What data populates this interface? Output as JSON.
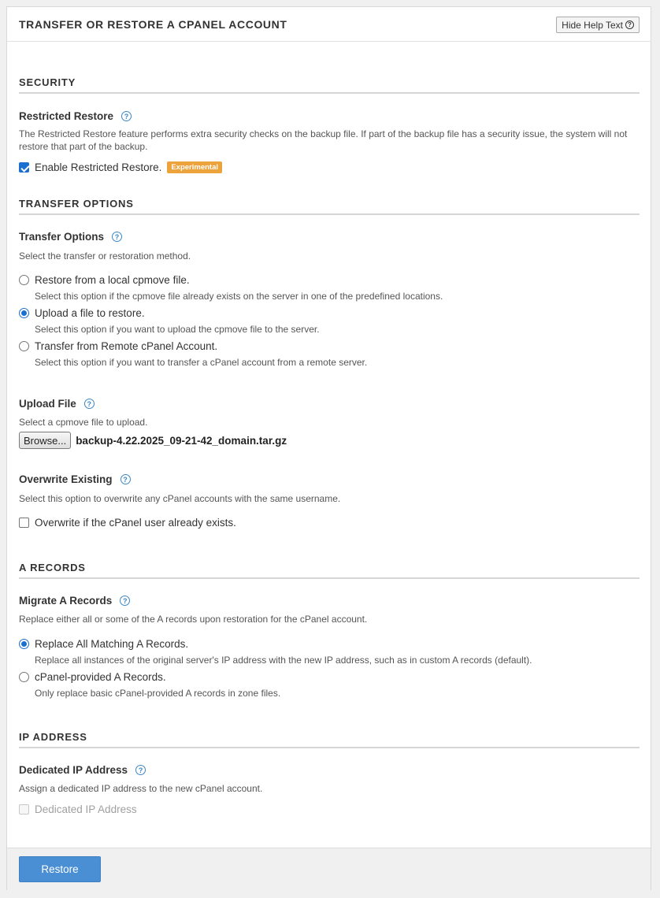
{
  "header": {
    "title": "TRANSFER OR RESTORE A CPANEL ACCOUNT",
    "help_toggle_label": "Hide Help Text"
  },
  "security": {
    "section_title": "SECURITY",
    "restricted_restore": {
      "label": "Restricted Restore",
      "help": "The Restricted Restore feature performs extra security checks on the backup file. If part of the backup file has a security issue, the system will not restore that part of the backup.",
      "checkbox_label": "Enable Restricted Restore.",
      "checked": true,
      "badge": "Experimental",
      "badge_color": "#eda33c"
    }
  },
  "transfer_options": {
    "section_title": "TRANSFER OPTIONS",
    "label": "Transfer Options",
    "help": "Select the transfer or restoration method.",
    "options": [
      {
        "label": "Restore from a local cpmove file.",
        "desc": "Select this option if the cpmove file already exists on the server in one of the predefined locations.",
        "selected": false
      },
      {
        "label": "Upload a file to restore.",
        "desc": "Select this option if you want to upload the cpmove file to the server.",
        "selected": true
      },
      {
        "label": "Transfer from Remote cPanel Account.",
        "desc": "Select this option if you want to transfer a cPanel account from a remote server.",
        "selected": false
      }
    ]
  },
  "upload_file": {
    "label": "Upload File",
    "help": "Select a cpmove file to upload.",
    "browse_label": "Browse...",
    "file_name": "backup-4.22.2025_09-21-42_domain.tar.gz"
  },
  "overwrite": {
    "label": "Overwrite Existing",
    "help": "Select this option to overwrite any cPanel accounts with the same username.",
    "checkbox_label": "Overwrite if the cPanel user already exists.",
    "checked": false
  },
  "a_records": {
    "section_title": "A RECORDS",
    "label": "Migrate A Records",
    "help": "Replace either all or some of the A records upon restoration for the cPanel account.",
    "options": [
      {
        "label": "Replace All Matching A Records.",
        "desc": "Replace all instances of the original server's IP address with the new IP address, such as in custom A records (default).",
        "selected": true
      },
      {
        "label": "cPanel-provided A Records.",
        "desc": "Only replace basic cPanel-provided A records in zone files.",
        "selected": false
      }
    ]
  },
  "ip_address": {
    "section_title": "IP ADDRESS",
    "label": "Dedicated IP Address",
    "help": "Assign a dedicated IP address to the new cPanel account.",
    "checkbox_label": "Dedicated IP Address",
    "checked": false,
    "disabled": true
  },
  "footer": {
    "restore_label": "Restore",
    "accent_color": "#4a8fd4"
  }
}
